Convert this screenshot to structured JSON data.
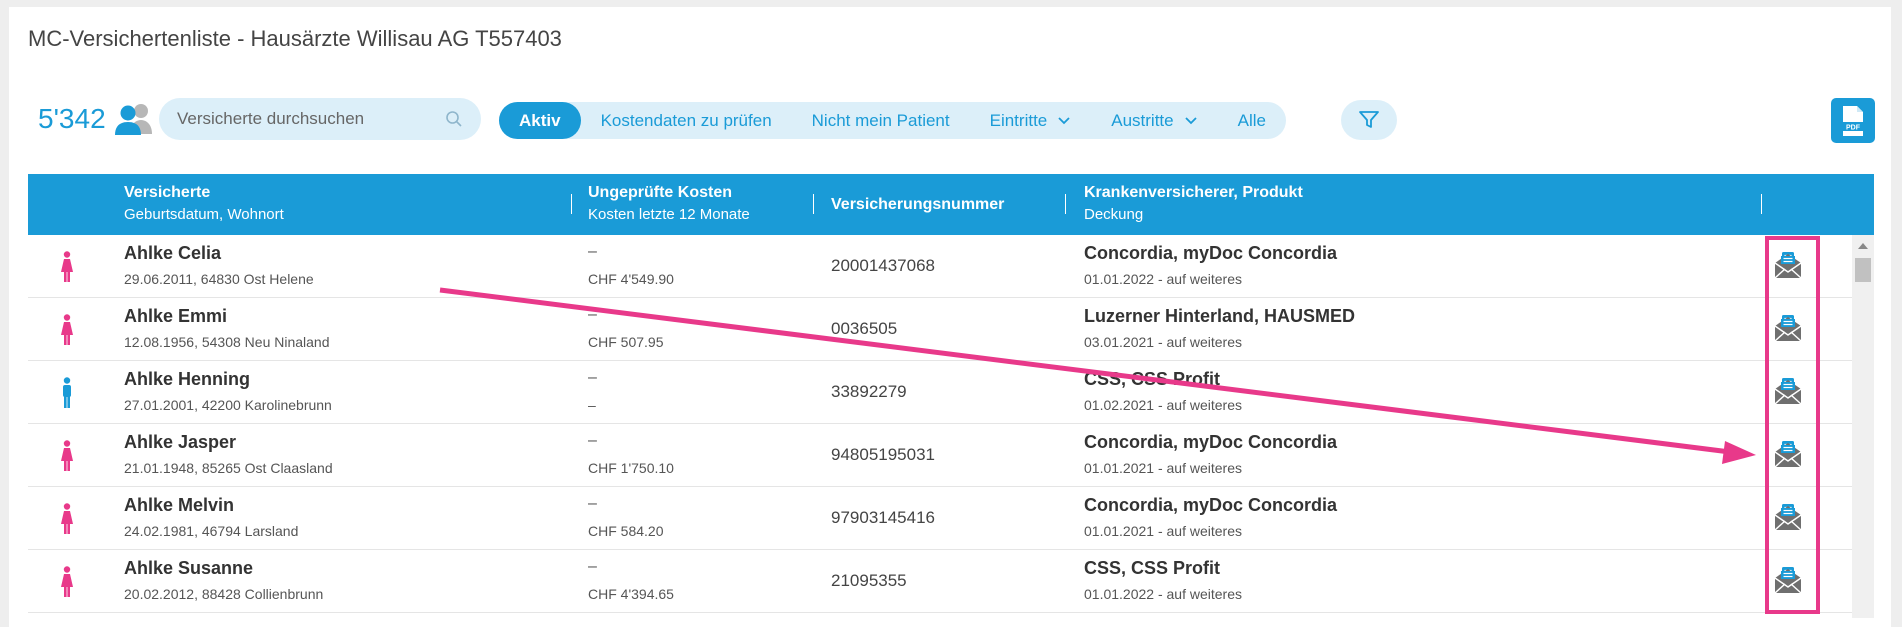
{
  "page": {
    "title": "MC-Versichertenliste - Hausärzte Willisau AG T557403"
  },
  "summary": {
    "count": "5'342",
    "icon": "users-icon"
  },
  "search": {
    "placeholder": "Versicherte durchsuchen",
    "icon": "search-icon"
  },
  "filters": {
    "tabs": [
      {
        "label": "Aktiv",
        "active": true
      },
      {
        "label": "Kostendaten zu prüfen"
      },
      {
        "label": "Nicht mein Patient"
      },
      {
        "label": "Eintritte",
        "dropdown": true
      },
      {
        "label": "Austritte",
        "dropdown": true
      },
      {
        "label": "Alle"
      }
    ],
    "filter_icon": "filter-icon",
    "pdf_icon": "pdf-icon"
  },
  "table": {
    "columns": [
      {
        "main": "Versicherte",
        "sub": "Geburtsdatum, Wohnort"
      },
      {
        "main": "Ungeprüfte Kosten",
        "sub": "Kosten letzte 12 Monate"
      },
      {
        "main": "Versicherungsnummer",
        "sub": ""
      },
      {
        "main": "Krankenversicherer, Produkt",
        "sub": "Deckung"
      }
    ],
    "rows": [
      {
        "gender": "female",
        "name": "Ahlke Celia",
        "birth": "29.06.2011, 64830 Ost Helene",
        "unchecked": "–",
        "cost12": "CHF 4'549.90",
        "insnr": "20001437068",
        "insurer": "Concordia, myDoc Concordia",
        "coverage": "01.01.2022 - auf weiteres"
      },
      {
        "gender": "female",
        "name": "Ahlke Emmi",
        "birth": "12.08.1956, 54308 Neu Ninaland",
        "unchecked": "–",
        "cost12": "CHF 507.95",
        "insnr": "0036505",
        "insurer": "Luzerner Hinterland, HAUSMED",
        "coverage": "03.01.2021 - auf weiteres"
      },
      {
        "gender": "male",
        "name": "Ahlke Henning",
        "birth": "27.01.2001, 42200 Karolinebrunn",
        "unchecked": "–",
        "cost12": "–",
        "insnr": "33892279",
        "insurer": "CSS, CSS Profit",
        "coverage": "01.02.2021 - auf weiteres"
      },
      {
        "gender": "female",
        "name": "Ahlke Jasper",
        "birth": "21.01.1948, 85265 Ost Claasland",
        "unchecked": "–",
        "cost12": "CHF 1'750.10",
        "insnr": "94805195031",
        "insurer": "Concordia, myDoc Concordia",
        "coverage": "01.01.2021 - auf weiteres"
      },
      {
        "gender": "female",
        "name": "Ahlke Melvin",
        "birth": "24.02.1981, 46794 Larsland",
        "unchecked": "–",
        "cost12": "CHF 584.20",
        "insnr": "97903145416",
        "insurer": "Concordia, myDoc Concordia",
        "coverage": "01.01.2021 - auf weiteres"
      },
      {
        "gender": "female",
        "name": "Ahlke Susanne",
        "birth": "20.02.2012, 88428 Collienbrunn",
        "unchecked": "–",
        "cost12": "CHF 4'394.65",
        "insnr": "21095355",
        "insurer": "CSS, CSS Profit",
        "coverage": "01.01.2022 - auf weiteres"
      }
    ]
  },
  "annotation": {
    "color": "#e8398a"
  },
  "colors": {
    "accent": "#1a9bd7",
    "female": "#e8398a",
    "male": "#1a9bd7"
  }
}
